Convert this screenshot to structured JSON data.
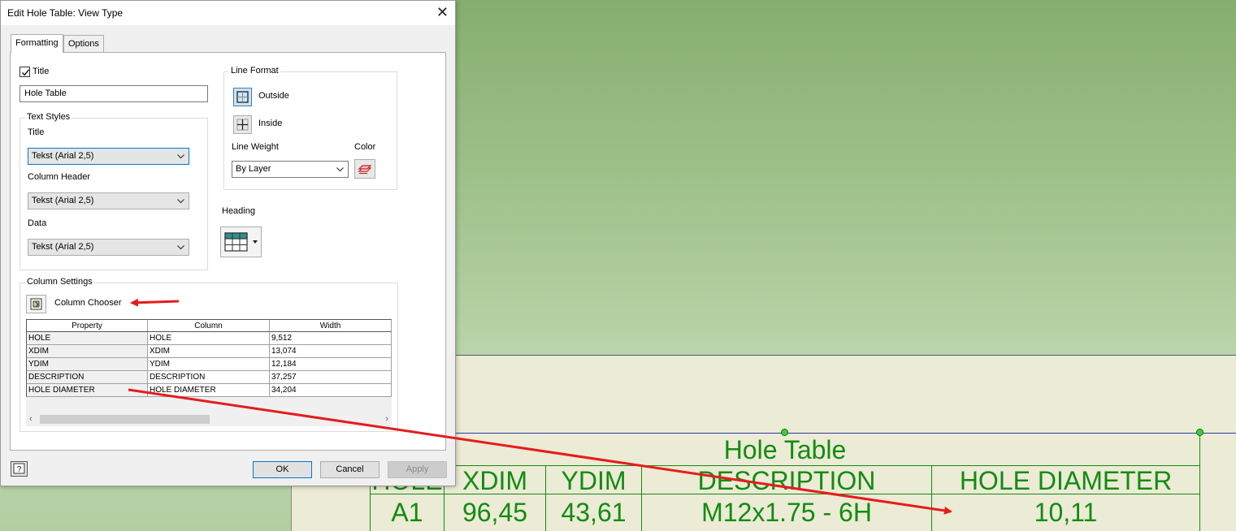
{
  "dialog": {
    "title": "Edit Hole Table: View Type",
    "tabs": [
      "Formatting",
      "Options"
    ],
    "title_checkbox_label": "Title",
    "title_checked": true,
    "title_value": "Hole Table",
    "text_styles": {
      "group_label": "Text Styles",
      "title_label": "Title",
      "title_value": "Tekst (Arial 2,5)",
      "column_header_label": "Column Header",
      "column_header_value": "Tekst (Arial 2,5)",
      "data_label": "Data",
      "data_value": "Tekst (Arial 2,5)"
    },
    "line_format": {
      "group_label": "Line Format",
      "outside_label": "Outside",
      "inside_label": "Inside",
      "line_weight_label": "Line Weight",
      "line_weight_value": "By Layer",
      "color_label": "Color"
    },
    "heading_label": "Heading",
    "column_settings": {
      "group_label": "Column Settings",
      "chooser_label": "Column Chooser",
      "headers": [
        "Property",
        "Column",
        "Width"
      ],
      "rows": [
        [
          "HOLE",
          "HOLE",
          "9,512"
        ],
        [
          "XDIM",
          "XDIM",
          "13,074"
        ],
        [
          "YDIM",
          "YDIM",
          "12,184"
        ],
        [
          "DESCRIPTION",
          "DESCRIPTION",
          "37,257"
        ],
        [
          "HOLE DIAMETER",
          "HOLE DIAMETER",
          "34,204"
        ]
      ]
    },
    "buttons": {
      "ok": "OK",
      "cancel": "Cancel",
      "apply": "Apply"
    }
  },
  "drawing": {
    "table_title": "Hole Table",
    "headers": [
      "HOLE",
      "XDIM",
      "YDIM",
      "DESCRIPTION",
      "HOLE DIAMETER"
    ],
    "row": [
      "A1",
      "96,45",
      "43,61",
      "M12x1.75 - 6H",
      "10,11"
    ],
    "text_color": "#128c12"
  },
  "annotation_color": "#e51c1c"
}
